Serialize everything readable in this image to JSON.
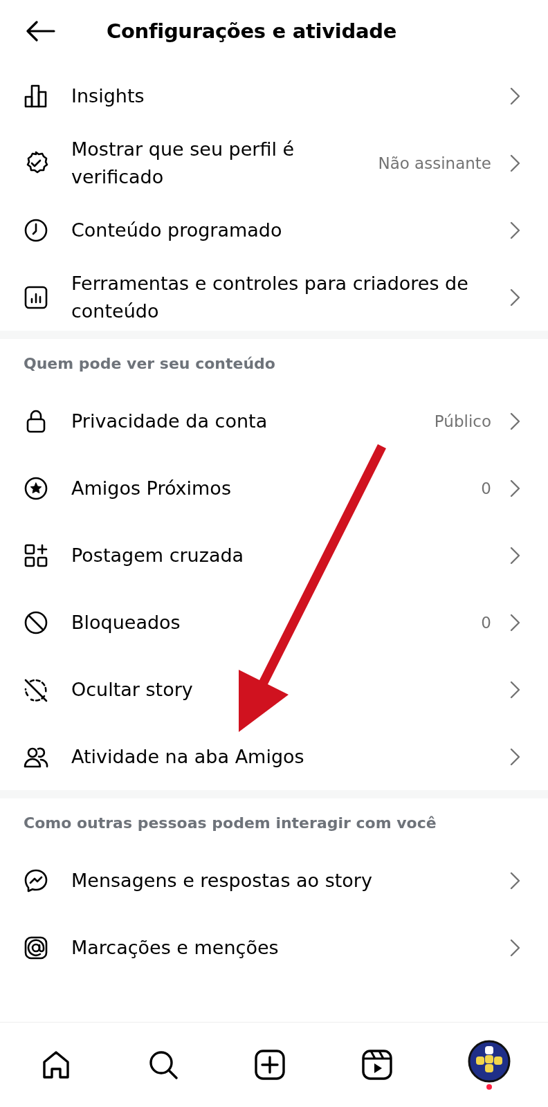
{
  "header": {
    "title": "Configurações e atividade"
  },
  "sections": [
    {
      "items": [
        {
          "kind": "insights",
          "label": "Insights"
        },
        {
          "kind": "verified",
          "label": "Mostrar que seu perfil é verificado",
          "value": "Não assinante"
        },
        {
          "kind": "scheduled",
          "label": "Conteúdo programado"
        },
        {
          "kind": "creator",
          "label": "Ferramentas e controles para criadores de conteúdo"
        }
      ]
    },
    {
      "heading": "Quem pode ver seu conteúdo",
      "items": [
        {
          "kind": "privacy",
          "label": "Privacidade da conta",
          "value": "Público"
        },
        {
          "kind": "close_friends",
          "label": "Amigos Próximos",
          "value": "0"
        },
        {
          "kind": "crosspost",
          "label": "Postagem cruzada"
        },
        {
          "kind": "blocked",
          "label": "Bloqueados",
          "value": "0"
        },
        {
          "kind": "hide_story",
          "label": "Ocultar story"
        },
        {
          "kind": "friends",
          "label": "Atividade na aba Amigos"
        }
      ]
    },
    {
      "heading": "Como outras pessoas podem interagir com você",
      "items": [
        {
          "kind": "messages",
          "label": "Mensagens e respostas ao story"
        },
        {
          "kind": "mentions",
          "label": "Marcações e menções"
        }
      ]
    }
  ],
  "nav": [
    {
      "kind": "home"
    },
    {
      "kind": "search"
    },
    {
      "kind": "create"
    },
    {
      "kind": "reels"
    },
    {
      "kind": "profile",
      "notification": true
    }
  ]
}
